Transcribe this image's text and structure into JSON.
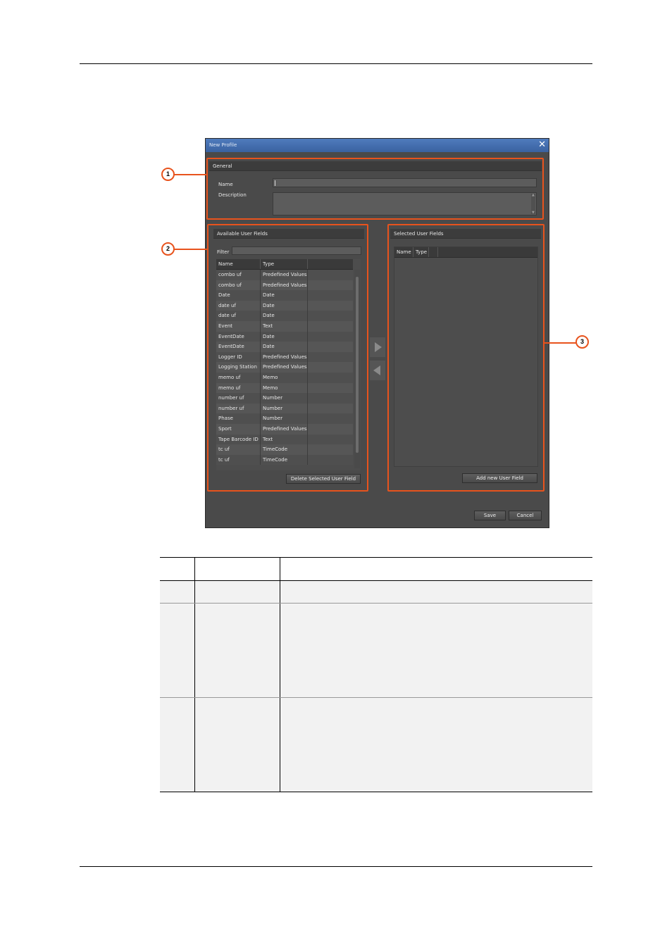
{
  "dialog": {
    "title": "New Profile",
    "close_icon": "close-icon",
    "general": {
      "header": "General",
      "name_label": "Name",
      "description_label": "Description",
      "name_value": "",
      "description_value": ""
    },
    "available": {
      "header": "Available User Fields",
      "filter_label": "Filter",
      "filter_value": "",
      "columns": [
        "Name",
        "Type"
      ],
      "rows": [
        [
          "combo uf",
          "Predefined Values"
        ],
        [
          "combo uf",
          "Predefined Values"
        ],
        [
          "Date",
          "Date"
        ],
        [
          "date uf",
          "Date"
        ],
        [
          "date uf",
          "Date"
        ],
        [
          "Event",
          "Text"
        ],
        [
          "EventDate",
          "Date"
        ],
        [
          "EventDate",
          "Date"
        ],
        [
          "Logger ID",
          "Predefined Values"
        ],
        [
          "Logging Station",
          "Predefined Values"
        ],
        [
          "memo uf",
          "Memo"
        ],
        [
          "memo uf",
          "Memo"
        ],
        [
          "number uf",
          "Number"
        ],
        [
          "number uf",
          "Number"
        ],
        [
          "Phase",
          "Number"
        ],
        [
          "Sport",
          "Predefined Values"
        ],
        [
          "Tape Barcode ID",
          "Text"
        ],
        [
          "tc uf",
          "TimeCode"
        ],
        [
          "tc uf",
          "TimeCode"
        ]
      ],
      "delete_button": "Delete Selected User Field"
    },
    "selected": {
      "header": "Selected User Fields",
      "columns": [
        "Name",
        "Type"
      ],
      "add_button": "Add new User Field"
    },
    "save_button": "Save",
    "cancel_button": "Cancel"
  },
  "callouts": [
    "1",
    "2",
    "3"
  ],
  "colors": {
    "highlight": "#e8531d",
    "dialog_bg": "#4a4a4a",
    "titlebar": "#3a62a0",
    "table_band": "#f2f2f2"
  }
}
